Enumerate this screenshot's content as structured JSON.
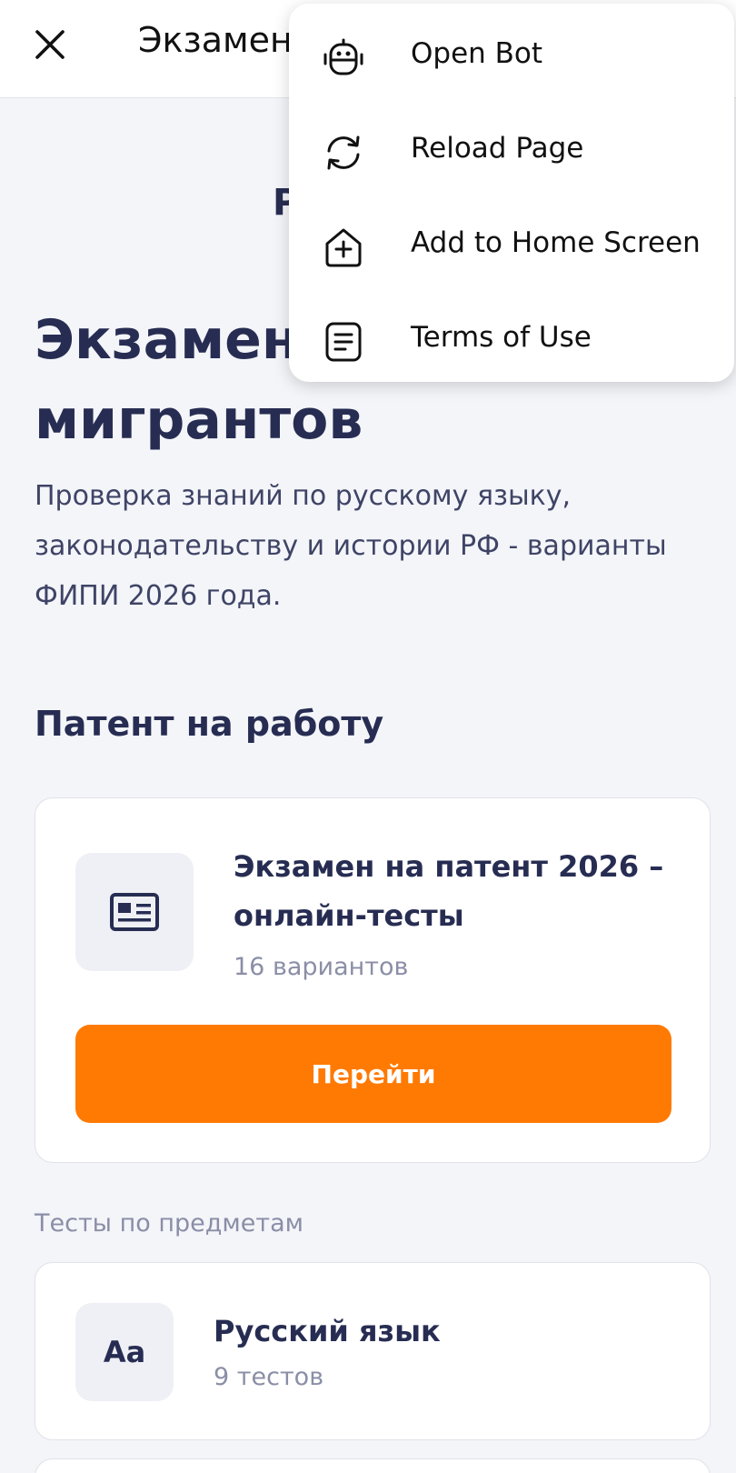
{
  "topbar": {
    "title": "Экзамен"
  },
  "page": {
    "hidden_subtitle": "Р",
    "hero_title": "Экзамен для мигрантов",
    "hero_description": "Проверка знаний по русскому языку, законодательству и истории РФ - варианты ФИПИ 2026 года.",
    "section_title": "Патент на работу",
    "patent_card": {
      "title": "Экзамен на патент 2026 – онлайн-тесты",
      "subtitle": "16 вариантов",
      "button_label": "Перейти"
    },
    "subjects_label": "Тесты по предметам",
    "russian_card": {
      "icon_text": "Aa",
      "title": "Русский язык",
      "subtitle": "9 тестов"
    }
  },
  "menu": {
    "items": [
      {
        "label": "Open Bot",
        "icon": "robot-icon"
      },
      {
        "label": "Reload Page",
        "icon": "reload-icon"
      },
      {
        "label": "Add to Home Screen",
        "icon": "add-home-icon"
      },
      {
        "label": "Terms of Use",
        "icon": "document-icon"
      }
    ]
  },
  "colors": {
    "accent": "#ff7a03",
    "text_primary": "#272d52",
    "text_muted": "#8a8ea6",
    "background": "#f4f5f9"
  }
}
